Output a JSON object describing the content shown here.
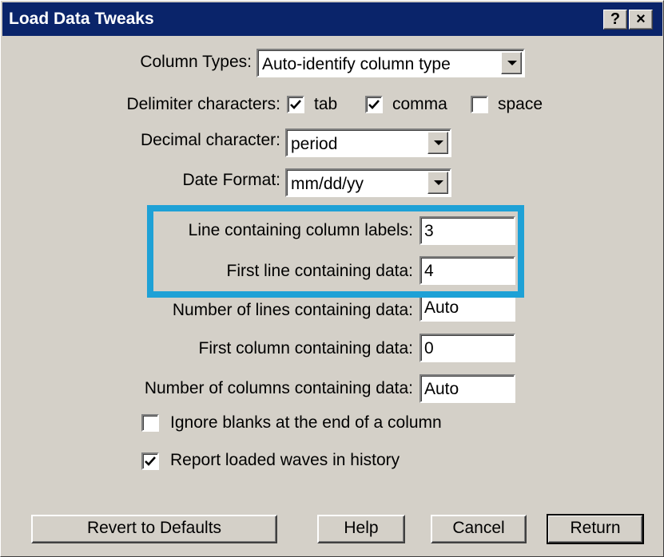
{
  "window": {
    "title": "Load Data Tweaks",
    "help_glyph": "?",
    "close_glyph": "×"
  },
  "column_types": {
    "label": "Column Types:",
    "value": "Auto-identify column type"
  },
  "delimiters": {
    "label": "Delimiter characters:",
    "items": [
      {
        "label": "tab",
        "checked": true
      },
      {
        "label": "comma",
        "checked": true
      },
      {
        "label": "space",
        "checked": false
      }
    ]
  },
  "decimal": {
    "label": "Decimal character:",
    "value": "period"
  },
  "date_format": {
    "label": "Date Format:",
    "value": "mm/dd/yy"
  },
  "fields": {
    "line_labels": {
      "label": "Line containing column labels:",
      "value": "3"
    },
    "first_line_data": {
      "label": "First line containing data:",
      "value": "4"
    },
    "num_lines": {
      "label": "Number of lines containing data:",
      "value": "Auto"
    },
    "first_column": {
      "label": "First column containing data:",
      "value": "0"
    },
    "num_columns": {
      "label": "Number of columns containing data:",
      "value": "Auto"
    }
  },
  "options": {
    "ignore_blanks": {
      "label": "Ignore blanks at the end of a column",
      "checked": false
    },
    "report_waves": {
      "label": "Report loaded waves in history",
      "checked": true
    }
  },
  "buttons": {
    "revert": "Revert to Defaults",
    "help": "Help",
    "cancel": "Cancel",
    "return": "Return"
  },
  "colors": {
    "titlebar": "#0a246a",
    "dialog_face": "#d4d0c8",
    "highlight": "#1ea1d6"
  }
}
